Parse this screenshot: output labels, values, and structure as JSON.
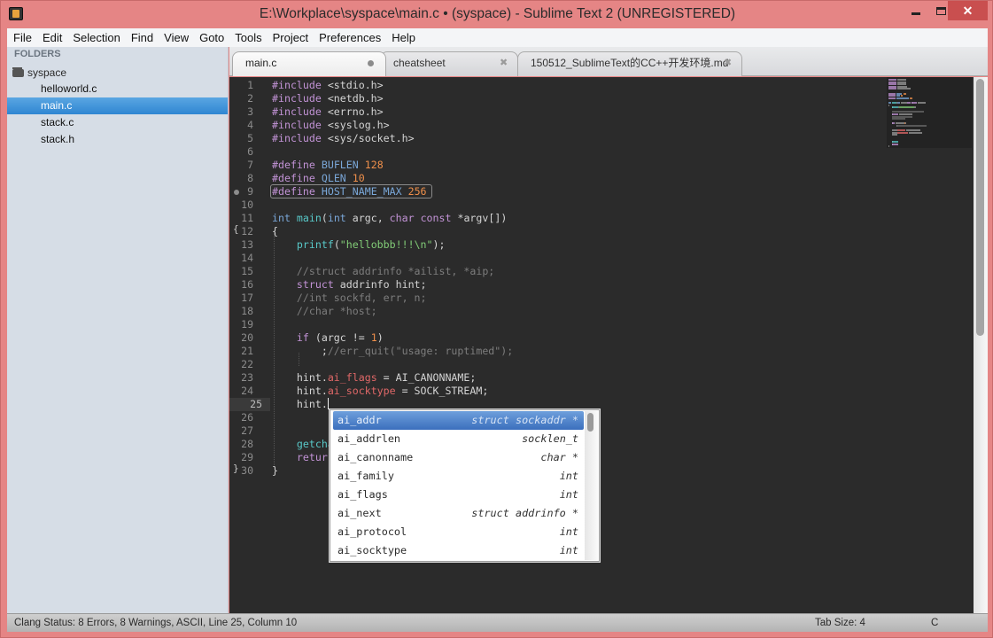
{
  "window": {
    "title": "E:\\Workplace\\syspace\\main.c • (syspace) - Sublime Text 2 (UNREGISTERED)",
    "controls": {
      "minimize": "minimize-icon",
      "maximize": "maximize-icon",
      "close": "✕"
    }
  },
  "menu": [
    "File",
    "Edit",
    "Selection",
    "Find",
    "View",
    "Goto",
    "Tools",
    "Project",
    "Preferences",
    "Help"
  ],
  "sidebar": {
    "header": "FOLDERS",
    "folder": "syspace",
    "files": [
      {
        "name": "helloworld.c",
        "selected": false
      },
      {
        "name": "main.c",
        "selected": true
      },
      {
        "name": "stack.c",
        "selected": false
      },
      {
        "name": "stack.h",
        "selected": false
      }
    ]
  },
  "tabs": [
    {
      "label": "main.c",
      "active": true,
      "dirty": true
    },
    {
      "label": "cheatsheet",
      "active": false,
      "dirty": false,
      "close": "✖"
    },
    {
      "label": "150512_SublimeText的CC++开发环境.md",
      "active": false,
      "dirty": false,
      "close": "✖"
    }
  ],
  "editor": {
    "current_line": 25,
    "lines": [
      [
        [
          "pp",
          "#include"
        ],
        [
          "inc",
          " <stdio.h>"
        ]
      ],
      [
        [
          "pp",
          "#include"
        ],
        [
          "inc",
          " <netdb.h>"
        ]
      ],
      [
        [
          "pp",
          "#include"
        ],
        [
          "inc",
          " <errno.h>"
        ]
      ],
      [
        [
          "pp",
          "#include"
        ],
        [
          "inc",
          " <syslog.h>"
        ]
      ],
      [
        [
          "pp",
          "#include"
        ],
        [
          "inc",
          " <sys/socket.h>"
        ]
      ],
      [],
      [
        [
          "pp",
          "#define"
        ],
        [
          "",
          ""
        ],
        [
          "cn",
          " BUFLEN"
        ],
        [
          "n",
          " 128"
        ]
      ],
      [
        [
          "pp",
          "#define"
        ],
        [
          "cn",
          " QLEN"
        ],
        [
          "n",
          " 10"
        ]
      ],
      [
        [
          "pp",
          "#define"
        ],
        [
          "cn",
          " HOST_NAME_MAX"
        ],
        [
          "n",
          " 256"
        ]
      ],
      [],
      [
        [
          "t",
          "int"
        ],
        [
          "",
          ""
        ],
        [
          "fn",
          " main"
        ],
        [
          "",
          "("
        ],
        [
          "t",
          "int"
        ],
        [
          "",
          " argc, "
        ],
        [
          "k",
          "char"
        ],
        [
          "",
          " "
        ],
        [
          "k",
          "const"
        ],
        [
          "",
          " *argv[])"
        ]
      ],
      [
        [
          "",
          "{"
        ]
      ],
      [
        [
          "",
          "    "
        ],
        [
          "fn",
          "printf"
        ],
        [
          "",
          "("
        ],
        [
          "s",
          "\"hellobbb!!!\\n\""
        ],
        [
          "",
          ");"
        ]
      ],
      [],
      [
        [
          "c",
          "    //struct addrinfo *ailist, *aip;"
        ]
      ],
      [
        [
          "",
          "    "
        ],
        [
          "k",
          "struct"
        ],
        [
          "",
          " addrinfo hint;"
        ]
      ],
      [
        [
          "c",
          "    //int sockfd, err, n;"
        ]
      ],
      [
        [
          "c",
          "    //char *host;"
        ]
      ],
      [],
      [
        [
          "",
          "    "
        ],
        [
          "k",
          "if"
        ],
        [
          "",
          " (argc != "
        ],
        [
          "n",
          "1"
        ],
        [
          "",
          ")"
        ]
      ],
      [
        [
          "",
          "        ;"
        ],
        [
          "c",
          "//err_quit(\"usage: ruptimed\");"
        ]
      ],
      [],
      [
        [
          "",
          "    hint."
        ],
        [
          "m",
          "ai_flags"
        ],
        [
          "",
          " = AI_CANONNAME;"
        ]
      ],
      [
        [
          "",
          "    hint."
        ],
        [
          "m",
          "ai_socktype"
        ],
        [
          "",
          " = SOCK_STREAM;"
        ]
      ],
      [
        [
          "",
          "    hint."
        ]
      ],
      [],
      [],
      [
        [
          "",
          "    "
        ],
        [
          "fn",
          "getcha"
        ]
      ],
      [
        [
          "",
          "    "
        ],
        [
          "k",
          "returr"
        ]
      ],
      [
        [
          "",
          "}"
        ]
      ]
    ]
  },
  "autocomplete": {
    "items": [
      {
        "name": "ai_addr",
        "type": "struct sockaddr *",
        "selected": true
      },
      {
        "name": "ai_addrlen",
        "type": "socklen_t",
        "selected": false
      },
      {
        "name": "ai_canonname",
        "type": "char *",
        "selected": false
      },
      {
        "name": "ai_family",
        "type": "int",
        "selected": false
      },
      {
        "name": "ai_flags",
        "type": "int",
        "selected": false
      },
      {
        "name": "ai_next",
        "type": "struct addrinfo *",
        "selected": false
      },
      {
        "name": "ai_protocol",
        "type": "int",
        "selected": false
      },
      {
        "name": "ai_socktype",
        "type": "int",
        "selected": false
      }
    ]
  },
  "statusbar": {
    "left": "Clang Status: 8 Errors, 8 Warnings, ASCII, Line 25, Column 10",
    "tab_size": "Tab Size: 4",
    "syntax": "C"
  }
}
